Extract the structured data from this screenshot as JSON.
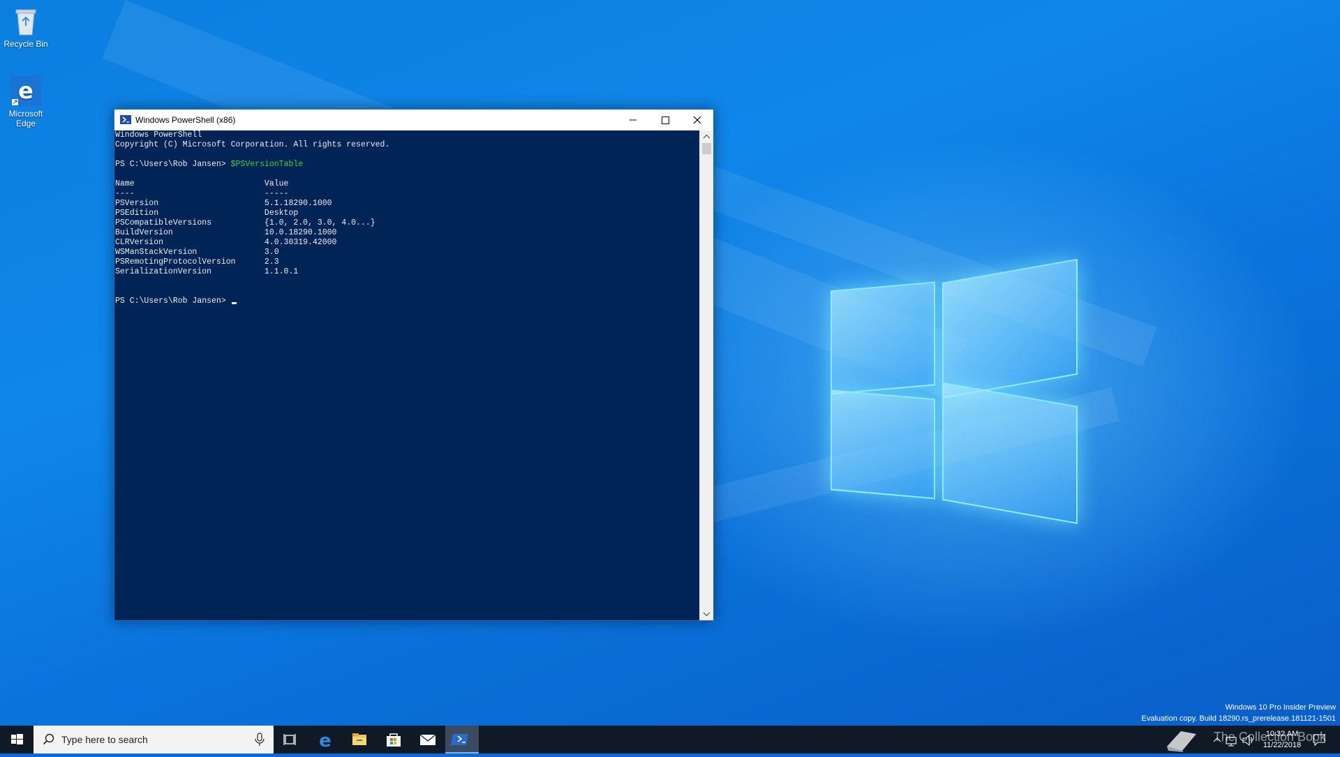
{
  "desktop": {
    "icons": [
      {
        "label": "Recycle Bin",
        "icon": "recycle-bin-icon"
      },
      {
        "label": "Microsoft Edge",
        "icon": "edge-icon"
      }
    ]
  },
  "window": {
    "title": "Windows PowerShell (x86)",
    "controls": [
      "minimize",
      "maximize",
      "close"
    ]
  },
  "console": {
    "lines": [
      "Windows PowerShell",
      "Copyright (C) Microsoft Corporation. All rights reserved.",
      "",
      "PS C:\\Users\\Rob Jansen> $PSVersionTable",
      "",
      "Name                           Value",
      "----                           -----",
      "PSVersion                      5.1.18290.1000",
      "PSEdition                      Desktop",
      "PSCompatibleVersions           {1.0, 2.0, 3.0, 4.0...}",
      "BuildVersion                   10.0.18290.1000",
      "CLRVersion                     4.0.30319.42000",
      "WSManStackVersion              3.0",
      "PSRemotingProtocolVersion      2.3",
      "SerializationVersion           1.1.0.1",
      "",
      "",
      "PS C:\\Users\\Rob Jansen> "
    ],
    "prompt": "PS C:\\Users\\Rob Jansen> ",
    "command": "$PSVersionTable",
    "colors": {
      "background": "#012456",
      "text": "#eeedf0",
      "command": "#3cd23c"
    }
  },
  "taskbar": {
    "search_placeholder": "Type here to search",
    "apps": [
      "task-view-icon",
      "edge-icon",
      "file-explorer-icon",
      "store-icon",
      "mail-icon",
      "powershell-icon"
    ],
    "clock": {
      "time": "10:32 AM",
      "date": "11/22/2018"
    }
  },
  "watermark": {
    "line1": "Windows 10 Pro Insider Preview",
    "line2": "Evaluation copy. Build 18290.rs_prerelease.181121-1501",
    "overlay": "The Collection Book"
  }
}
